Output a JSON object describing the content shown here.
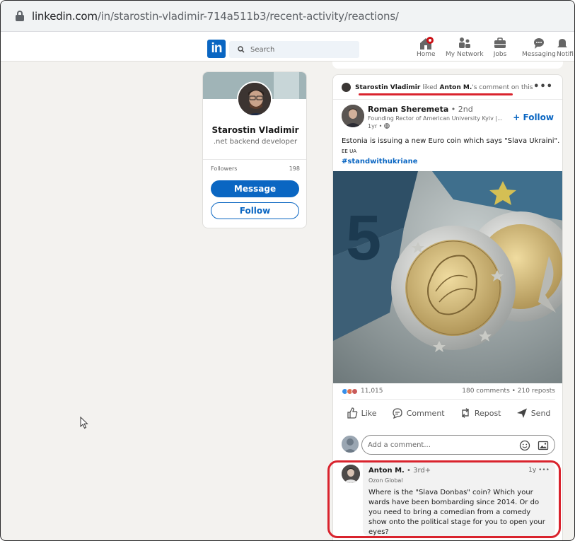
{
  "browser": {
    "url_domain": "linkedin.com",
    "url_path": "/in/starostin-vladimir-714a511b3/recent-activity/reactions/"
  },
  "nav": {
    "logo": "in",
    "search_placeholder": "Search",
    "items": [
      {
        "label": "Home",
        "icon": "home-icon"
      },
      {
        "label": "My Network",
        "icon": "network-icon"
      },
      {
        "label": "Jobs",
        "icon": "jobs-icon"
      },
      {
        "label": "Messaging",
        "icon": "messaging-icon"
      },
      {
        "label": "Notifi",
        "icon": "notifications-icon"
      }
    ]
  },
  "profile": {
    "name": "Starostin Vladimir",
    "title": ".net backend developer",
    "followers_label": "Followers",
    "followers_count": "198",
    "message_label": "Message",
    "follow_label": "Follow"
  },
  "post": {
    "activity": {
      "actor": "Starostin Vladimir",
      "verb": "liked",
      "target": "Anton M.",
      "suffix": "'s comment on this"
    },
    "author": {
      "name": "Roman Sheremeta",
      "degree": "• 2nd",
      "subtitle": "Founding Rector of American University Kyiv |...",
      "time": "1yr •"
    },
    "follow_label": "+ Follow",
    "text": "Estonia is issuing a new Euro coin which says \"Slava Ukraini\".",
    "lang": "EE UA",
    "hashtag": "#standwithukriane",
    "reactions_count": "11,015",
    "comments_reposts": "180 comments • 210 reposts",
    "actions": {
      "like": "Like",
      "comment": "Comment",
      "repost": "Repost",
      "send": "Send"
    },
    "comment_placeholder": "Add a comment...",
    "comment": {
      "name": "Anton M.",
      "degree": "• 3rd+",
      "time": "1y •••",
      "org": "Ozon Global",
      "text": "Where is the \"Slava Donbas\" coin? Which your wards have been bombarding since 2014. Or do you need to bring a comedian from a comedy show onto the political stage for you to open your eyes?"
    }
  },
  "colors": {
    "linkedin_blue": "#0a66c2",
    "highlight_red": "#d9232d"
  }
}
